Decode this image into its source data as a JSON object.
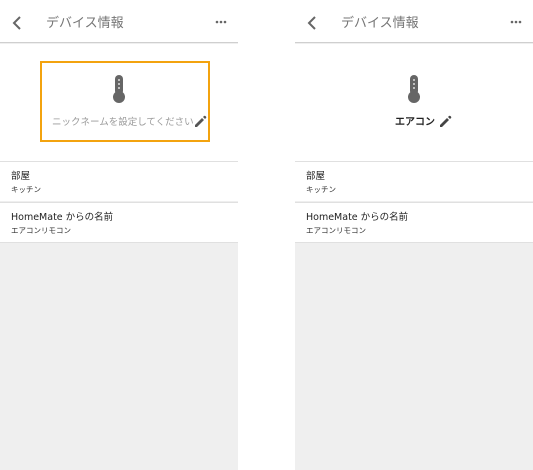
{
  "screens": [
    {
      "header": {
        "title": "デバイス情報",
        "back_icon": "chevron-left-icon",
        "menu_icon": "more-horizontal-icon"
      },
      "device": {
        "icon": "thermometer-icon",
        "placeholder": "ニックネームを設定してください",
        "nickname": "",
        "edit_icon": "pencil-icon",
        "highlight_color": "#f3a30f"
      },
      "room": {
        "label": "部屋",
        "value": "キッチン"
      },
      "homemate": {
        "label": "HomeMate からの名前",
        "value": "エアコンリモコン"
      }
    },
    {
      "header": {
        "title": "デバイス情報",
        "back_icon": "chevron-left-icon",
        "menu_icon": "more-horizontal-icon"
      },
      "device": {
        "icon": "thermometer-icon",
        "placeholder": "",
        "nickname": "エアコン",
        "edit_icon": "pencil-icon"
      },
      "room": {
        "label": "部屋",
        "value": "キッチン"
      },
      "homemate": {
        "label": "HomeMate からの名前",
        "value": "エアコンリモコン"
      }
    }
  ],
  "colors": {
    "background": "#efefef",
    "header_title": "#757575",
    "icon": "#666666"
  }
}
